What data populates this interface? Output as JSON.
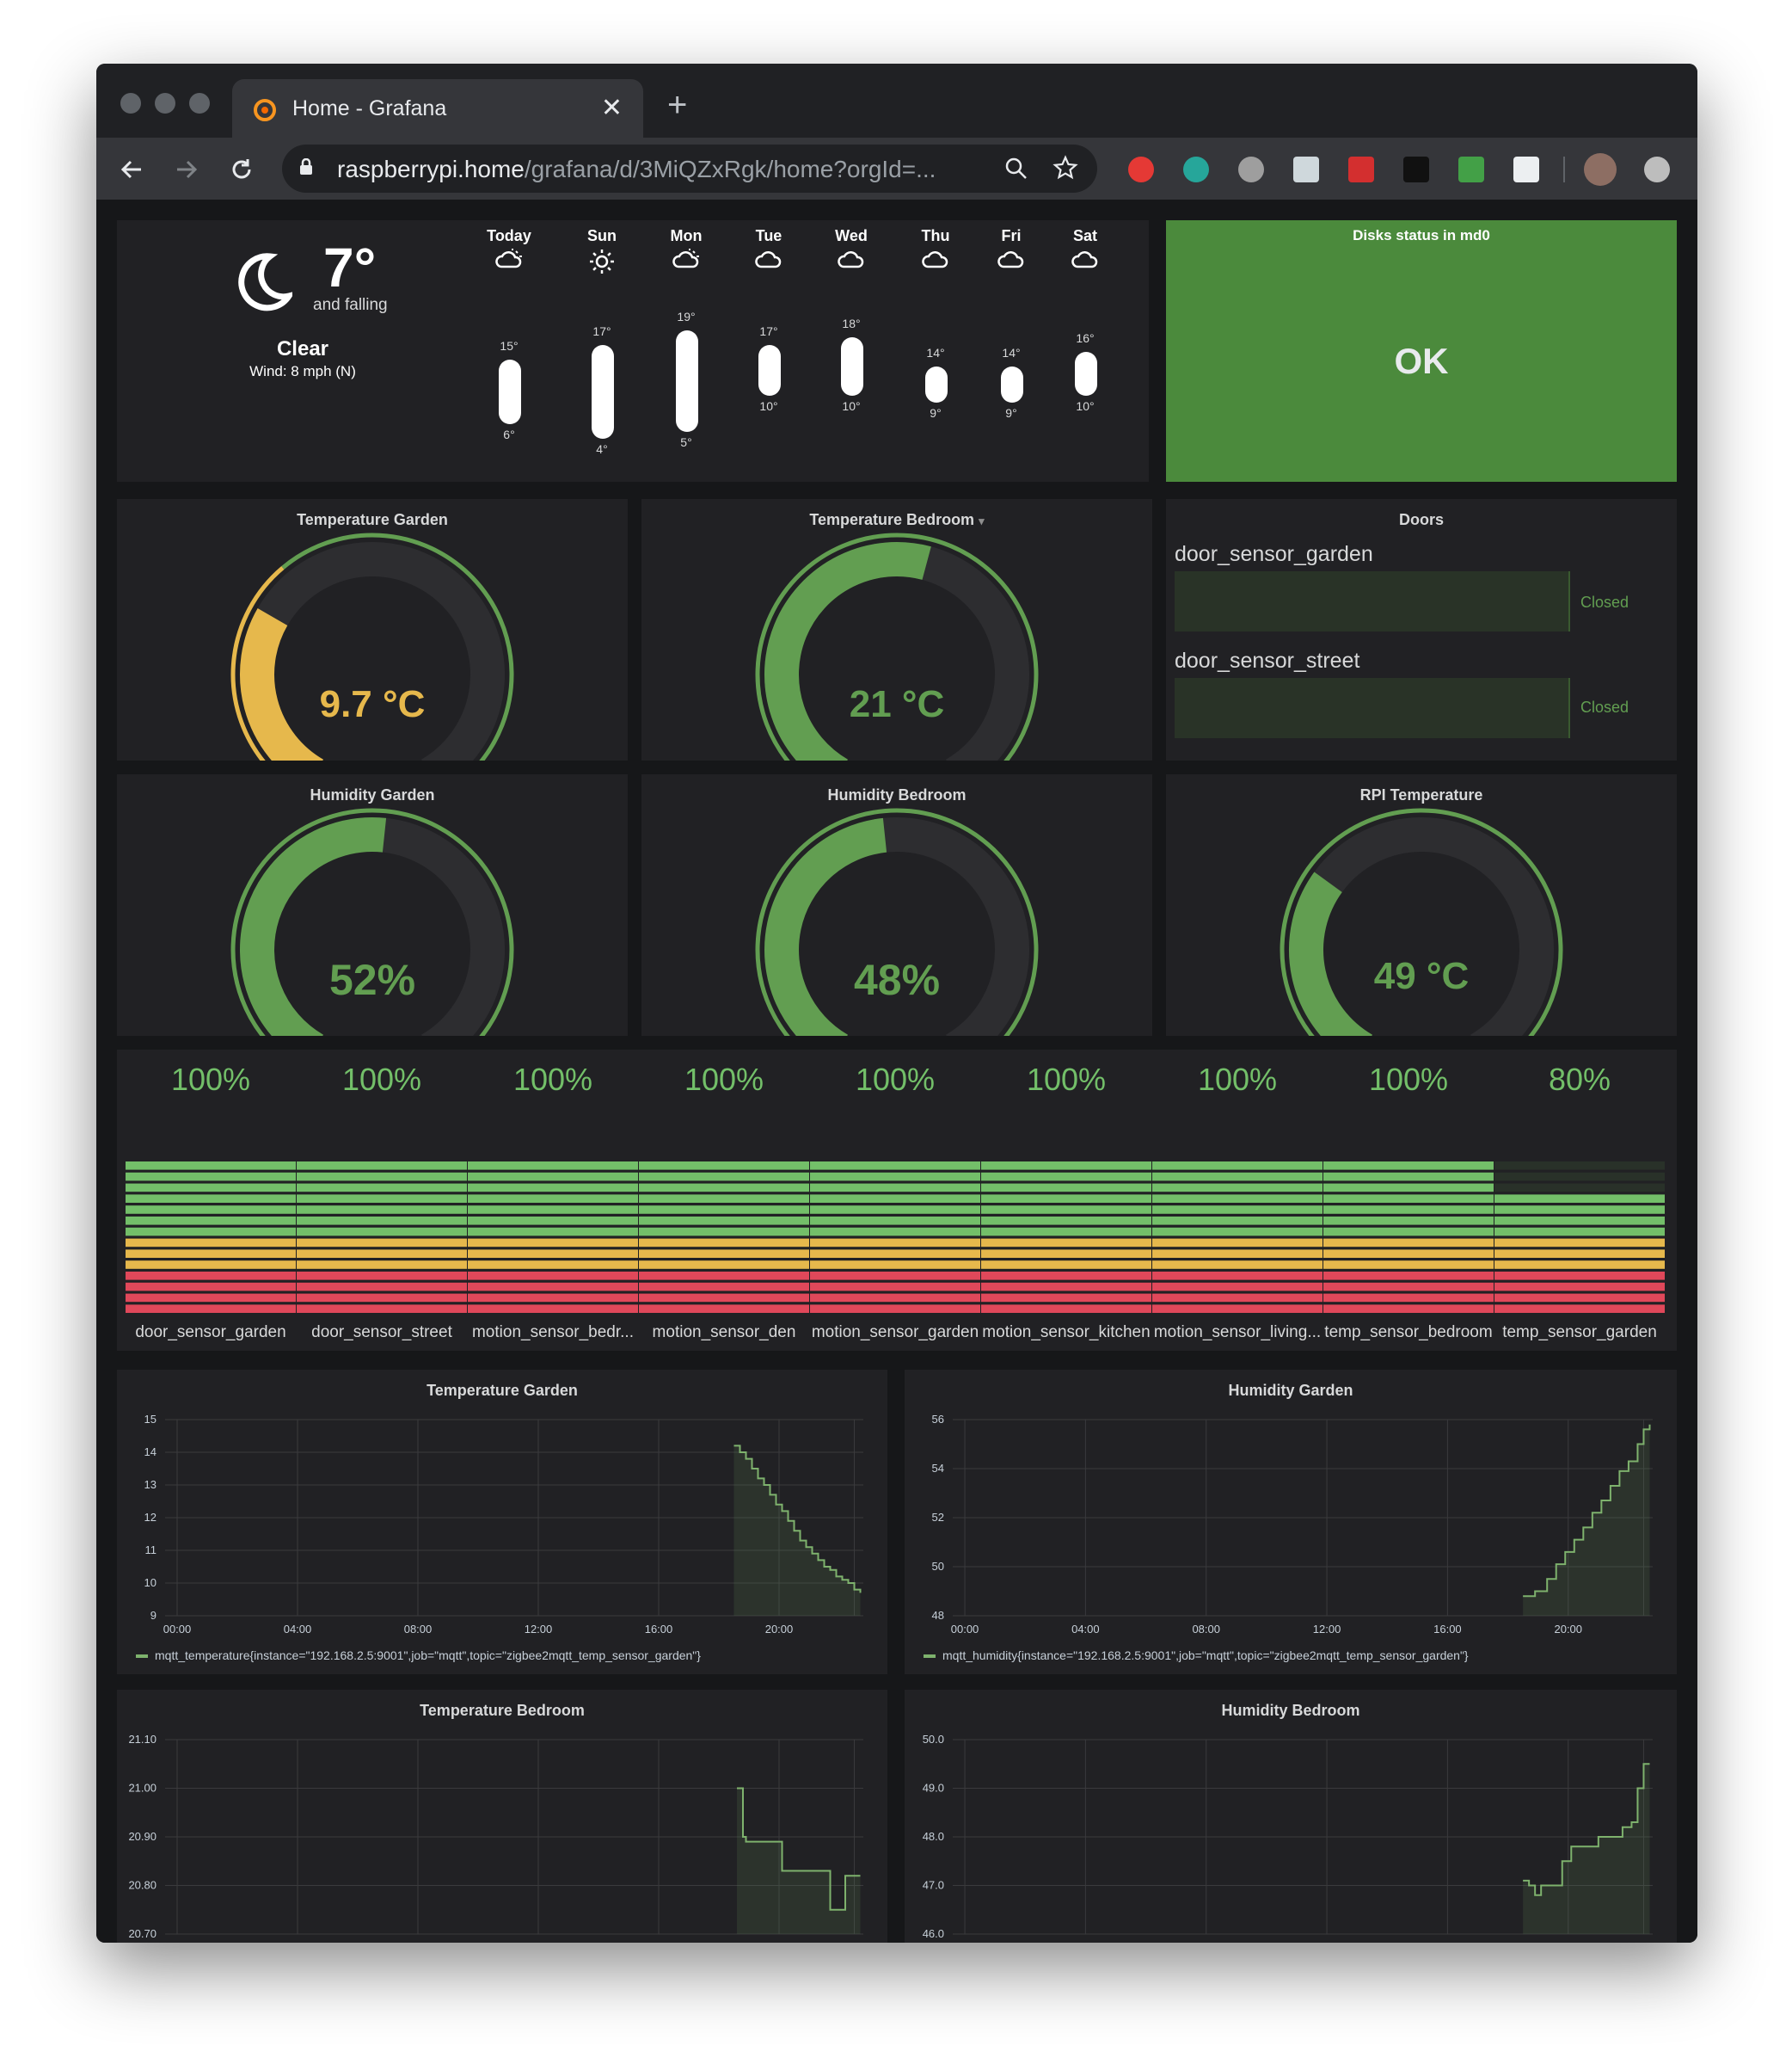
{
  "browser": {
    "tab_title": "Home - Grafana",
    "url_host": "raspberrypi.home",
    "url_path": "/grafana/d/3MiQZxRgk/home?orgId=...",
    "close_symbol": "✕",
    "new_tab_symbol": "+"
  },
  "weather": {
    "current_temp": "7°",
    "trend": "and falling",
    "condition": "Clear",
    "wind": "Wind: 8 mph (N)",
    "days": [
      {
        "day": "Today",
        "icon": "partly-cloudy-night-icon",
        "high": "15°",
        "low": "6°",
        "high_val": 15,
        "low_val": 6
      },
      {
        "day": "Sun",
        "icon": "sun-icon",
        "high": "17°",
        "low": "4°",
        "high_val": 17,
        "low_val": 4
      },
      {
        "day": "Mon",
        "icon": "partly-cloudy-icon",
        "high": "19°",
        "low": "5°",
        "high_val": 19,
        "low_val": 5
      },
      {
        "day": "Tue",
        "icon": "cloud-icon",
        "high": "17°",
        "low": "10°",
        "high_val": 17,
        "low_val": 10
      },
      {
        "day": "Wed",
        "icon": "cloud-icon",
        "high": "18°",
        "low": "10°",
        "high_val": 18,
        "low_val": 10
      },
      {
        "day": "Thu",
        "icon": "cloud-icon",
        "high": "14°",
        "low": "9°",
        "high_val": 14,
        "low_val": 9
      },
      {
        "day": "Fri",
        "icon": "cloud-icon",
        "high": "14°",
        "low": "9°",
        "high_val": 14,
        "low_val": 9
      },
      {
        "day": "Sat",
        "icon": "cloud-icon",
        "high": "16°",
        "low": "10°",
        "high_val": 16,
        "low_val": 10
      }
    ]
  },
  "disks": {
    "title": "Disks status in md0",
    "status": "OK",
    "color": "#4b8a3c"
  },
  "gauges": [
    {
      "title": "Temperature Garden",
      "value": "9.7 °C",
      "fraction": 0.3,
      "color": "#e6b84c"
    },
    {
      "title": "Temperature Bedroom",
      "value": "21 °C",
      "fraction": 0.55,
      "color": "#629e51"
    },
    {
      "title": "Humidity Garden",
      "value": "52%",
      "fraction": 0.52,
      "color": "#629e51"
    },
    {
      "title": "Humidity Bedroom",
      "value": "48%",
      "fraction": 0.48,
      "color": "#629e51"
    },
    {
      "title": "RPI Temperature",
      "value": "49 °C",
      "fraction": 0.32,
      "color": "#629e51"
    }
  ],
  "doors": {
    "title": "Doors",
    "items": [
      {
        "name": "door_sensor_garden",
        "state": "Closed"
      },
      {
        "name": "door_sensor_street",
        "state": "Closed"
      }
    ]
  },
  "batteries": [
    {
      "label": "door_sensor_garden",
      "pct": "100%",
      "value": 100
    },
    {
      "label": "door_sensor_street",
      "pct": "100%",
      "value": 100
    },
    {
      "label": "motion_sensor_bedr...",
      "pct": "100%",
      "value": 100
    },
    {
      "label": "motion_sensor_den",
      "pct": "100%",
      "value": 100
    },
    {
      "label": "motion_sensor_garden",
      "pct": "100%",
      "value": 100
    },
    {
      "label": "motion_sensor_kitchen",
      "pct": "100%",
      "value": 100
    },
    {
      "label": "motion_sensor_living...",
      "pct": "100%",
      "value": 100
    },
    {
      "label": "temp_sensor_bedroom",
      "pct": "100%",
      "value": 100
    },
    {
      "label": "temp_sensor_garden",
      "pct": "80%",
      "value": 80
    }
  ],
  "chart_data": [
    {
      "type": "line",
      "title": "Temperature Garden",
      "x_ticks": [
        "00:00",
        "04:00",
        "08:00",
        "12:00",
        "16:00",
        "20:00"
      ],
      "y_ticks": [
        "15",
        "14",
        "13",
        "12",
        "11",
        "10",
        "9"
      ],
      "ylim": [
        9,
        15
      ],
      "xlim": [
        0,
        23.2
      ],
      "series": [
        {
          "name": "mqtt_temperature{instance=\"192.168.2.5:9001\",job=\"mqtt\",topic=\"zigbee2mqtt_temp_sensor_garden\"}",
          "x": [
            18.9,
            19.1,
            19.3,
            19.5,
            19.7,
            19.9,
            20.1,
            20.3,
            20.5,
            20.7,
            20.9,
            21.1,
            21.3,
            21.5,
            21.7,
            21.9,
            22.1,
            22.3,
            22.5,
            22.7,
            22.9,
            23.1
          ],
          "values": [
            14.2,
            14.0,
            13.8,
            13.5,
            13.2,
            13.0,
            12.7,
            12.4,
            12.2,
            11.9,
            11.6,
            11.3,
            11.1,
            10.9,
            10.7,
            10.5,
            10.4,
            10.2,
            10.1,
            10.0,
            9.8,
            9.7
          ]
        }
      ]
    },
    {
      "type": "line",
      "title": "Humidity Garden",
      "x_ticks": [
        "00:00",
        "04:00",
        "08:00",
        "12:00",
        "16:00",
        "20:00"
      ],
      "y_ticks": [
        "56",
        "54",
        "52",
        "50",
        "48"
      ],
      "ylim": [
        48,
        56
      ],
      "xlim": [
        0,
        23.2
      ],
      "series": [
        {
          "name": "mqtt_humidity{instance=\"192.168.2.5:9001\",job=\"mqtt\",topic=\"zigbee2mqtt_temp_sensor_garden\"}",
          "x": [
            18.9,
            19.3,
            19.7,
            20.0,
            20.3,
            20.6,
            20.9,
            21.2,
            21.5,
            21.8,
            22.1,
            22.4,
            22.7,
            22.9,
            23.1
          ],
          "values": [
            48.8,
            49.0,
            49.5,
            50.1,
            50.6,
            51.1,
            51.6,
            52.2,
            52.7,
            53.3,
            53.9,
            54.3,
            55.0,
            55.6,
            55.8
          ]
        }
      ]
    },
    {
      "type": "line",
      "title": "Temperature Bedroom",
      "x_ticks": [],
      "y_ticks": [
        "21.10",
        "21.00",
        "20.90",
        "20.80",
        "20.70"
      ],
      "ylim": [
        20.7,
        21.1
      ],
      "xlim": [
        0,
        23.2
      ],
      "series": [
        {
          "name": "",
          "x": [
            19.0,
            19.2,
            19.3,
            19.9,
            20.2,
            20.5,
            21.3,
            21.7,
            22.1,
            22.3,
            22.6,
            23.1
          ],
          "values": [
            21.0,
            20.9,
            20.89,
            20.89,
            20.89,
            20.83,
            20.83,
            20.83,
            20.75,
            20.75,
            20.82,
            20.82
          ]
        }
      ]
    },
    {
      "type": "line",
      "title": "Humidity Bedroom",
      "x_ticks": [],
      "y_ticks": [
        "50.0",
        "49.0",
        "48.0",
        "47.0",
        "46.0"
      ],
      "ylim": [
        46,
        50
      ],
      "xlim": [
        0,
        23.2
      ],
      "series": [
        {
          "name": "",
          "x": [
            18.9,
            19.1,
            19.3,
            19.5,
            19.9,
            20.2,
            20.5,
            21.0,
            21.4,
            21.8,
            22.2,
            22.5,
            22.7,
            22.9,
            23.1
          ],
          "values": [
            47.1,
            47.0,
            46.8,
            47.0,
            47.0,
            47.5,
            47.8,
            47.8,
            48.0,
            48.0,
            48.2,
            48.3,
            49.0,
            49.5,
            49.5
          ]
        }
      ]
    }
  ]
}
